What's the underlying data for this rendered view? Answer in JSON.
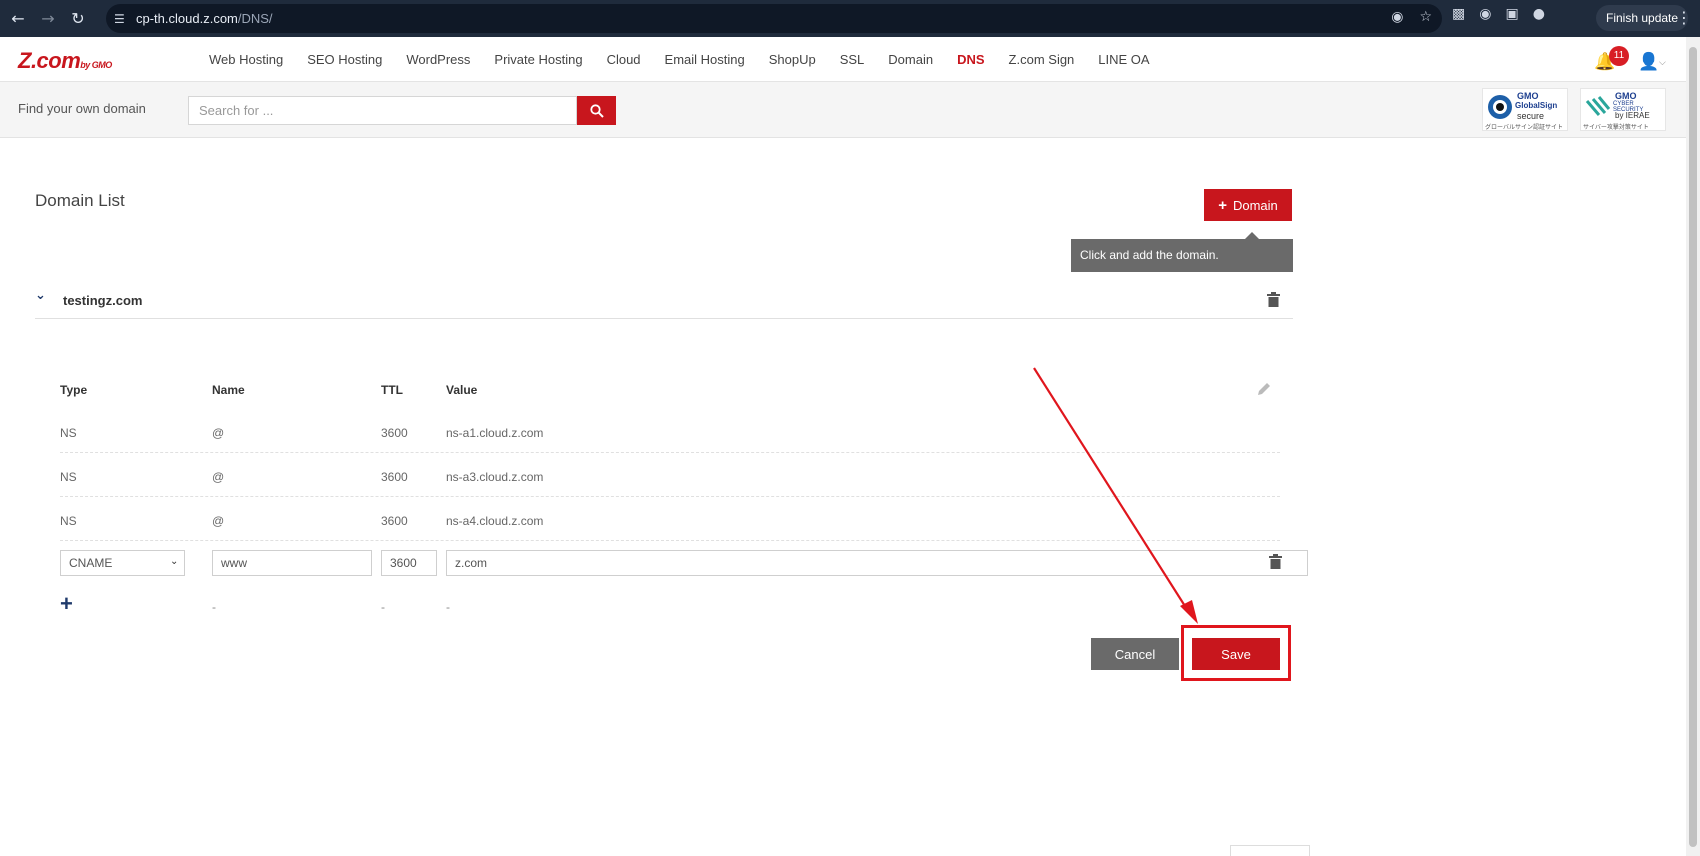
{
  "browser": {
    "url_host": "cp-th.cloud.z.com",
    "url_path": "/DNS/",
    "finish_update_label": "Finish update"
  },
  "header": {
    "logo_main": "Z.com",
    "logo_by": "by GMO",
    "menu": [
      {
        "label": "Web Hosting"
      },
      {
        "label": "SEO Hosting"
      },
      {
        "label": "WordPress"
      },
      {
        "label": "Private Hosting"
      },
      {
        "label": "Cloud"
      },
      {
        "label": "Email Hosting"
      },
      {
        "label": "ShopUp"
      },
      {
        "label": "SSL"
      },
      {
        "label": "Domain"
      },
      {
        "label": "DNS",
        "active": true
      },
      {
        "label": "Z.com Sign"
      },
      {
        "label": "LINE OA"
      }
    ],
    "notification_count": "11"
  },
  "search": {
    "label": "Find your own domain",
    "placeholder": "Search for ..."
  },
  "seals": {
    "globalsign": {
      "l1": "GMO",
      "l2": "GlobalSign",
      "l3": "secure",
      "l4": "グローバルサイン認証サイト"
    },
    "ierae": {
      "l1": "GMO",
      "l2": "CYBER SECURITY",
      "l3": "by IERAE",
      "l4": "サイバー攻撃対策サイト"
    }
  },
  "main": {
    "title": "Domain List",
    "add_domain_label": "Domain",
    "tooltip": "Click and add the domain.",
    "domain_name": "testingz.com"
  },
  "records": {
    "headers": {
      "type": "Type",
      "name": "Name",
      "ttl": "TTL",
      "value": "Value"
    },
    "rows": [
      {
        "type": "NS",
        "name": "@",
        "ttl": "3600",
        "value": "ns-a1.cloud.z.com"
      },
      {
        "type": "NS",
        "name": "@",
        "ttl": "3600",
        "value": "ns-a3.cloud.z.com"
      },
      {
        "type": "NS",
        "name": "@",
        "ttl": "3600",
        "value": "ns-a4.cloud.z.com"
      }
    ],
    "edit": {
      "type": "CNAME",
      "name": "www",
      "ttl": "3600",
      "value": "z.com"
    },
    "add_placeholder": "-"
  },
  "actions": {
    "cancel_label": "Cancel",
    "save_label": "Save"
  },
  "colors": {
    "brand_red": "#c8161d",
    "annotation_red": "#e0161d"
  }
}
